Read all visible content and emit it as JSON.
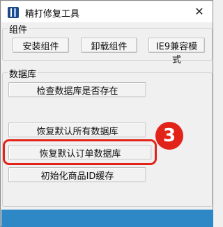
{
  "window": {
    "title": "精打修复工具",
    "close_glyph": "✕"
  },
  "components_group": {
    "label": "组件",
    "buttons": {
      "install": "安装组件",
      "uninstall": "卸载组件",
      "ie9": "IE9兼容模式"
    }
  },
  "database_group": {
    "label": "数据库",
    "buttons": {
      "check_exists": "检查数据库是否存在",
      "restore_all": "恢复默认所有数据库",
      "restore_order": "恢复默认订单数据库",
      "init_goods_cache": "初始化商品ID缓存"
    }
  },
  "annotation": {
    "step_number": "3",
    "highlight_color": "#e2231a"
  },
  "colors": {
    "bottom_bar": "#2e88c5",
    "app_icon": "#1e4a8a"
  },
  "icons": {
    "app": "app-icon",
    "close": "close-icon"
  }
}
